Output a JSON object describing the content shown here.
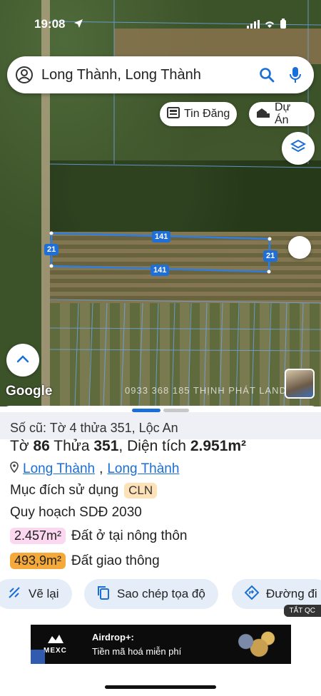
{
  "status_bar": {
    "time": "19:08"
  },
  "search": {
    "query": "Long Thành, Long Thành"
  },
  "chips": {
    "listings": "Tin Đăng",
    "projects": "Dự Án"
  },
  "map": {
    "plot_labels": [
      "141",
      "141",
      "21",
      "21"
    ],
    "attribution": "Google",
    "watermark": "0933 368 185  THỊNH PHÁT LAND"
  },
  "parcel": {
    "old_ref": "Số cũ: Tờ 4 thửa 351, Lộc An",
    "sheet_label": "Tờ",
    "sheet_no": "86",
    "lot_label": "Thửa",
    "lot_no": "351",
    "area_label": "Diện tích",
    "area": "2.951m²",
    "district": "Long Thành",
    "commune": "Long Thành",
    "land_use_label": "Mục đích sử dụng",
    "land_use_code": "CLN",
    "plan_title": "Quy hoạch SDĐ 2030",
    "zones": [
      {
        "area": "2.457m²",
        "label": "Đất ở tại nông thôn",
        "color": "#fbd7f0"
      },
      {
        "area": "493,9m²",
        "label": "Đất giao thông",
        "color": "#f5a93a"
      }
    ]
  },
  "actions": {
    "redraw": "Vẽ lại",
    "copy_coords": "Sao chép tọa độ",
    "directions": "Đường đi"
  },
  "ad": {
    "close_label": "TẮT QC",
    "brand": "MEXC",
    "title": "Airdrop+:",
    "text": "Tiền mã hoá miễn phí"
  },
  "colors": {
    "accent": "#1a6ed8",
    "plot_line": "#2f7de1"
  }
}
